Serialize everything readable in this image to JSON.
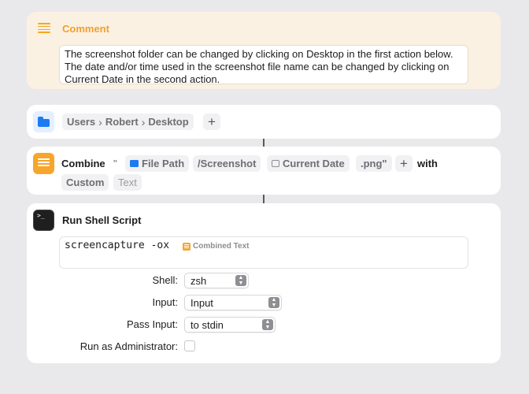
{
  "comment": {
    "title": "Comment",
    "text": "The screenshot folder can be changed by clicking on Desktop in the first action below. The date and/or time used in the screenshot file name can be changed by clicking on Current Date in the second action."
  },
  "path_action": {
    "segments": [
      "Users",
      "Robert",
      "Desktop"
    ],
    "separator": "›",
    "add_label": "+"
  },
  "combine_action": {
    "label": "Combine",
    "quote": "\"",
    "file_path": "File Path",
    "screenshot_text": "/Screenshot",
    "current_date": "Current Date",
    "extension": ".png\"",
    "add_label": "+",
    "with_label": "with",
    "separator_choice": "Custom",
    "custom_placeholder": "Text"
  },
  "shell_action": {
    "title": "Run Shell Script",
    "script": "screencapture -ox",
    "variable_token": "Combined Text",
    "shell_label": "Shell:",
    "shell_value": "zsh",
    "input_label": "Input:",
    "input_value": "Input",
    "pass_input_label": "Pass Input:",
    "pass_input_value": "to stdin",
    "admin_label": "Run as Administrator:",
    "admin_checked": false
  },
  "colors": {
    "accent_orange": "#f7a52b",
    "folder_blue": "#1c7bf2",
    "comment_bg": "#fbf1e2"
  }
}
